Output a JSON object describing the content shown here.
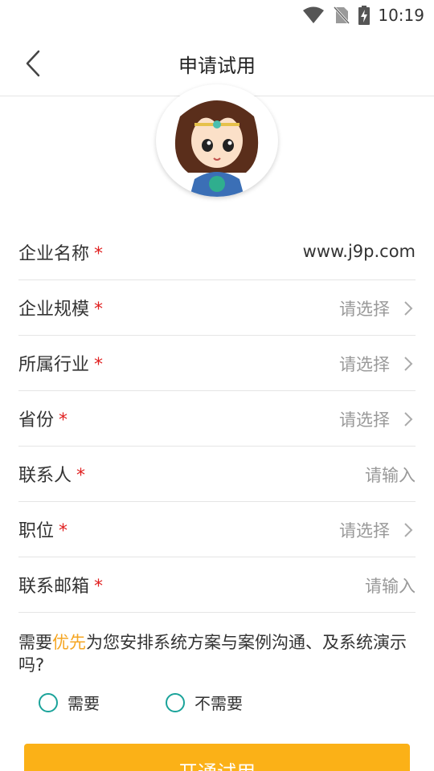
{
  "status_bar": {
    "time": "10:19",
    "icons": [
      "wifi-icon",
      "no-sim-icon",
      "battery-charging-icon"
    ]
  },
  "header": {
    "title": "申请试用",
    "back_icon": "chevron-left-icon"
  },
  "avatar": {
    "icon": "cartoon-avatar-icon"
  },
  "form": {
    "fields": [
      {
        "label": "企业名称",
        "required": "*",
        "value": "www.j9p.com"
      },
      {
        "label": "企业规模",
        "required": "*",
        "placeholder": "请选择",
        "type": "select"
      },
      {
        "label": "所属行业",
        "required": "*",
        "placeholder": "请选择",
        "type": "select"
      },
      {
        "label": "省份",
        "required": "*",
        "placeholder": "请选择",
        "type": "select"
      },
      {
        "label": "联系人",
        "required": "*",
        "placeholder": "请输入",
        "type": "input"
      },
      {
        "label": "职位",
        "required": "*",
        "placeholder": "请选择",
        "type": "select"
      },
      {
        "label": "联系邮箱",
        "required": "*",
        "placeholder": "请输入",
        "type": "input"
      }
    ]
  },
  "question": {
    "prefix": "需要",
    "highlight": "优先",
    "suffix": "为您安排系统方案与案例沟通、及系统演示吗?"
  },
  "options": [
    {
      "label": "需要"
    },
    {
      "label": "不需要"
    }
  ],
  "submit": {
    "label": "开通试用"
  },
  "colors": {
    "accent": "#fbb117",
    "highlight": "#f5a623",
    "required": "#e02020",
    "radio": "#1aa39a",
    "placeholder": "#999999"
  }
}
